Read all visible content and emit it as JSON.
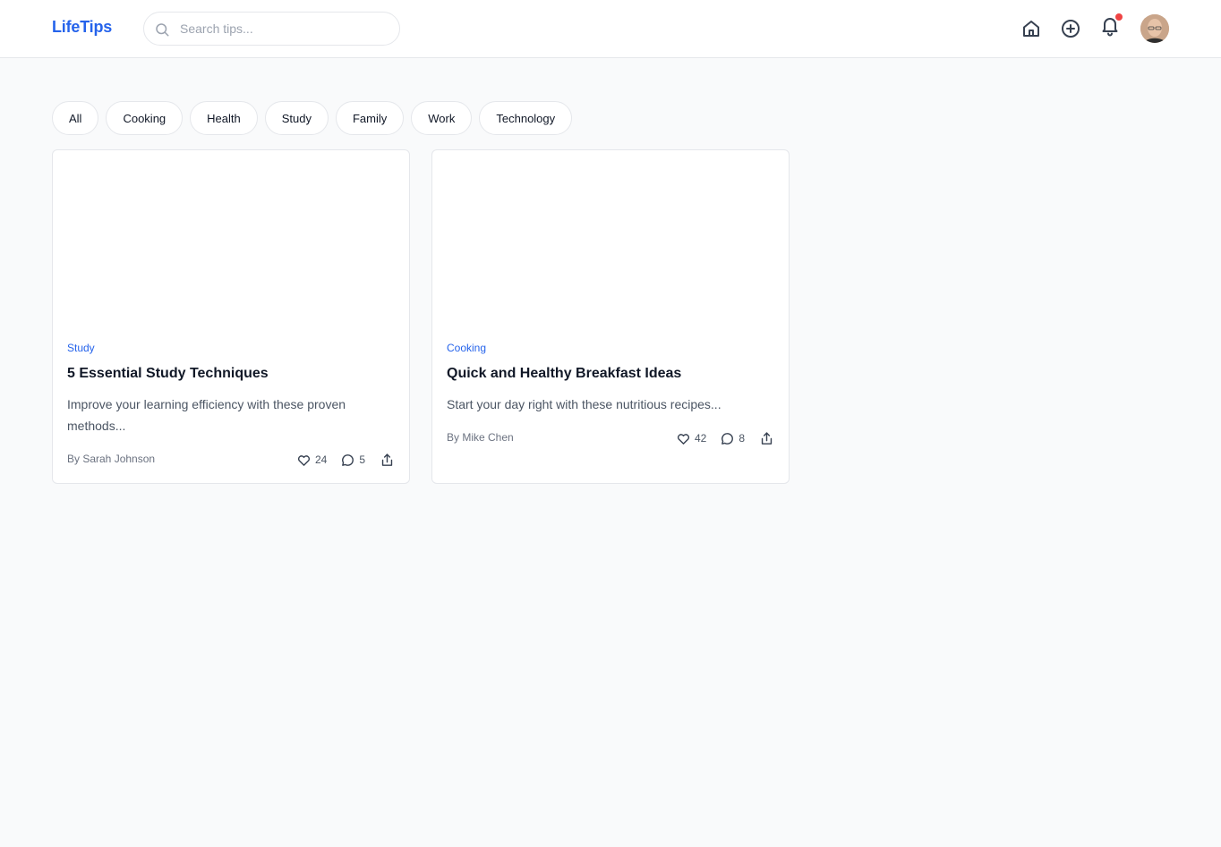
{
  "header": {
    "logo": "LifeTips",
    "search_placeholder": "Search tips...",
    "icons": [
      "search-icon",
      "home-icon",
      "plus-circle-icon",
      "bell-icon"
    ],
    "has_notification": true,
    "brand_color": "#2563eb",
    "notification_color": "#ef4444"
  },
  "filters": [
    "All",
    "Cooking",
    "Health",
    "Study",
    "Family",
    "Work",
    "Technology"
  ],
  "cards": [
    {
      "category": "Study",
      "title": "5 Essential Study Techniques",
      "description": "Improve your learning efficiency with these proven methods...",
      "author": "By Sarah Johnson",
      "likes": "24",
      "comments": "5"
    },
    {
      "category": "Cooking",
      "title": "Quick and Healthy Breakfast Ideas",
      "description": "Start your day right with these nutritious recipes...",
      "author": "By Mike Chen",
      "likes": "42",
      "comments": "8"
    }
  ]
}
